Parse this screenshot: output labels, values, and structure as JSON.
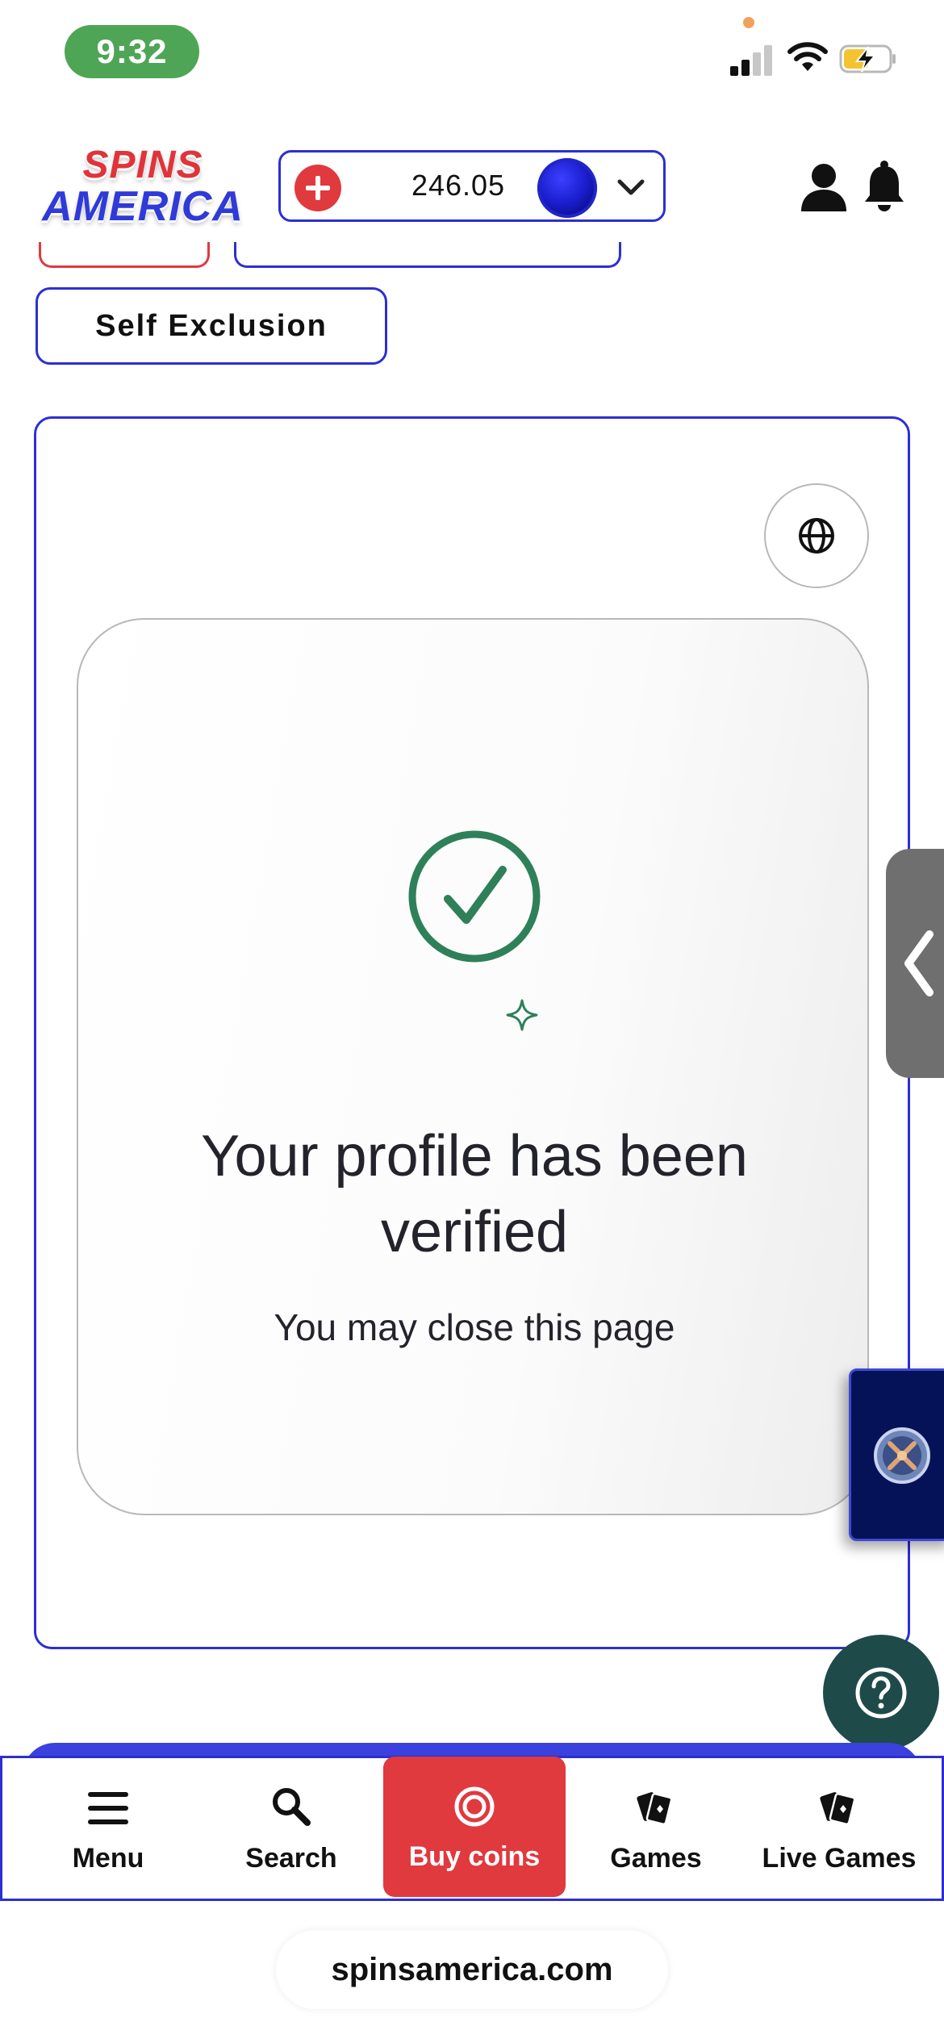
{
  "status_bar": {
    "time": "9:32",
    "icons": [
      "signal-icon",
      "wifi-icon",
      "battery-charging-icon"
    ]
  },
  "header": {
    "logo_top": "SPINS",
    "logo_bottom": "AMERICA",
    "wallet_balance": "246.05",
    "icons": [
      "add-coins-icon",
      "coin-icon",
      "chevron-down-icon",
      "user-icon",
      "bell-icon"
    ]
  },
  "self_exclusion_label": "Self Exclusion",
  "verification": {
    "title": "Your profile has been verified",
    "subtitle": "You may close this page",
    "icons": [
      "globe-icon",
      "check-circle-icon",
      "sparkle-icon"
    ]
  },
  "bottom_nav": {
    "items": [
      {
        "label": "Menu",
        "icon": "menu-icon"
      },
      {
        "label": "Search",
        "icon": "search-icon"
      },
      {
        "label": "Buy coins",
        "icon": "coins-icon"
      },
      {
        "label": "Games",
        "icon": "cards-icon"
      },
      {
        "label": "Live Games",
        "icon": "cards-icon"
      }
    ]
  },
  "url": "spinsamerica.com",
  "colors": {
    "brand_blue": "#2c2fd3",
    "brand_red": "#e0393e",
    "success_green": "#2e8059",
    "status_green": "#4fa556",
    "help_teal": "#1f4a4a"
  }
}
